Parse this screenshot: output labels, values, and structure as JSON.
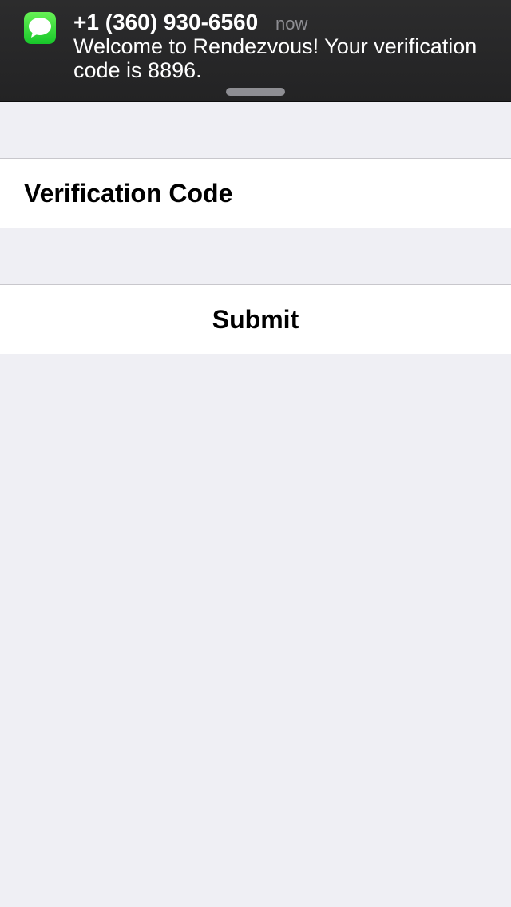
{
  "notification": {
    "app_icon": "messages-icon",
    "sender": "+1 (360) 930-6560",
    "time": "now",
    "message": "Welcome to Rendezvous! Your verification code is 8896."
  },
  "form": {
    "code_field": {
      "placeholder": "Verification Code",
      "value": ""
    },
    "submit_label": "Submit"
  },
  "colors": {
    "background": "#efeff4",
    "notification_background": "#262627",
    "messages_icon_green": "#2bd33a",
    "separator": "#c8c7cc"
  }
}
